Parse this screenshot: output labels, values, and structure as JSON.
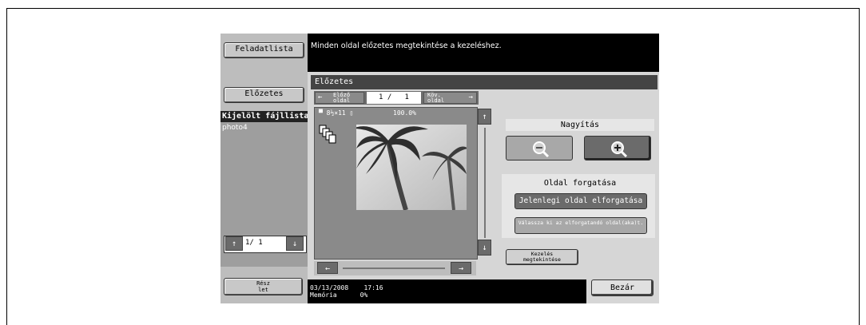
{
  "left": {
    "jobs_button": "Feladatlista",
    "preview_button": "Előzetes",
    "file_list_header": "Kijelölt fájllista",
    "files": [
      "photo4"
    ],
    "pager": {
      "up": "↑",
      "value": "1/  1",
      "down": "↓"
    },
    "details_button": "Rész\nlet"
  },
  "message": "Minden oldal előzetes megtekintése a kezeléshez.",
  "preview": {
    "title": "Előzetes",
    "prev_page_label": "Előző\noldal",
    "page_indicator": "1 /   1",
    "next_page_label": "Köv.\noldal",
    "info_paper": "8½×11",
    "info_zoom": "100.0%",
    "scroll_up": "↑",
    "scroll_down": "↓",
    "scroll_left": "←",
    "scroll_right": "→"
  },
  "zoom": {
    "title": "Nagyítás",
    "minus_icon": "zoom-out-icon",
    "plus_icon": "zoom-in-icon"
  },
  "rotate": {
    "title": "Oldal forgatása",
    "rotate_current": "Jelenlegi oldal elforgatása",
    "select_pages": "Válassza ki az elforgatandó oldal(aka)t."
  },
  "handle_view_button": "Kezelés\nmegtekintése",
  "footer": {
    "date": "03/13/2008",
    "time": "17:16",
    "memory_label": "Memória",
    "memory_value": "0%"
  },
  "close_button": "Bezár",
  "colors": {
    "panel": "#d6d6d6",
    "dark": "#000000",
    "header_bar": "#444444",
    "accent_button": "#6b6b6b"
  }
}
